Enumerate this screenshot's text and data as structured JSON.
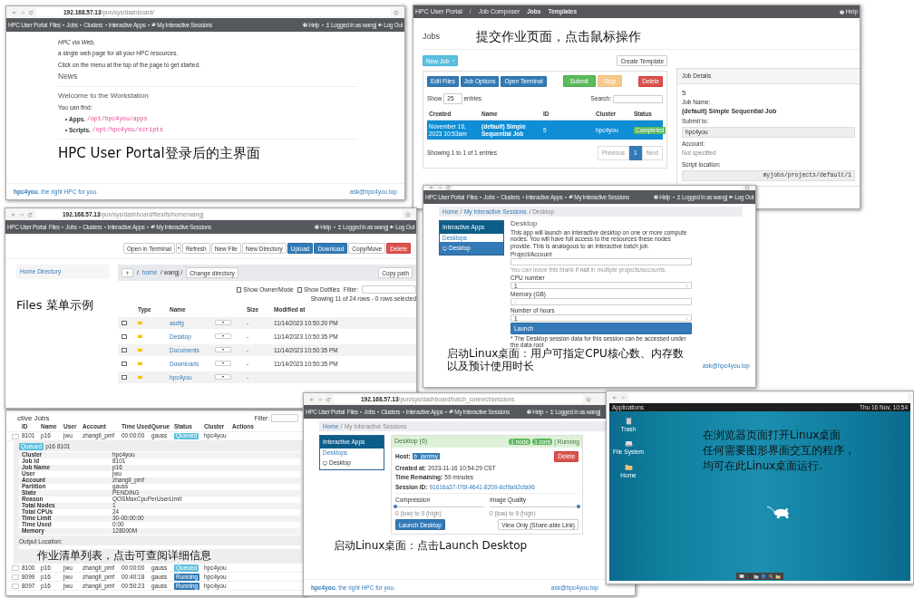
{
  "dashboard": {
    "browser": {
      "host": "192.168.57.13",
      "path": "/pun/sys/dashboard/"
    },
    "nav": {
      "brand": "HPC User Portal",
      "items": [
        {
          "label": "Files",
          "kind": "menu"
        },
        {
          "label": "Jobs",
          "kind": "menu"
        },
        {
          "label": "Clusters",
          "kind": "menu"
        },
        {
          "label": "Interactive Apps",
          "kind": "menu"
        },
        {
          "label": "My Interactive Sessions",
          "kind": "sessions"
        }
      ],
      "right": [
        {
          "label": "Help",
          "kind": "help"
        },
        {
          "label": "Logged in as wangj",
          "kind": "user"
        },
        {
          "label": "Log Out",
          "kind": "logout"
        }
      ]
    },
    "intro": [
      "*HPC via Web*,",
      "a single web page for all your HPC resources.",
      "Click on the menu at the top of the page to get started."
    ],
    "news_title": "News",
    "welcome": "Welcome to the Workstation",
    "find": "You can find:",
    "items": [
      {
        "label": "Apps.",
        "path": "/opt/hpc4you/apps"
      },
      {
        "label": "Scripts.",
        "path": "/opt/hpc4you/scripts"
      }
    ],
    "caption": "HPC User Portal登录后的主界面",
    "footer_left": "**hpc4you**, the right HPC for you.",
    "footer_right": "ask@hpc4you.top"
  },
  "job_composer": {
    "nav": {
      "brand": "HPC User Portal",
      "sep": "/",
      "title": "Job Composer",
      "links": [
        "Jobs",
        "Templates"
      ],
      "help": "Help"
    },
    "title": "Jobs",
    "caption": "提交作业页面，点击鼠标操作",
    "new_job": "New Job",
    "create_template": "Create Template",
    "actions": [
      {
        "label": "Edit Files",
        "kind": "primary"
      },
      {
        "label": "Job Options",
        "kind": "primary"
      },
      {
        "label": "Open Terminal",
        "kind": "primary"
      },
      {
        "label": "Submit",
        "kind": "success"
      },
      {
        "label": "Stop",
        "kind": "warning"
      },
      {
        "label": "Delete",
        "kind": "danger"
      }
    ],
    "show": "Show",
    "page_size": "25",
    "entries": "entries",
    "search": "Search:",
    "columns": [
      "Created",
      "Name",
      "ID",
      "Cluster",
      "Status"
    ],
    "rows": [
      {
        "created": "November 16, 2023 10:53am",
        "name": "(default) Simple Sequential Job",
        "id": "5",
        "cluster": "hpc4you",
        "status": "Completed",
        "selected": true
      }
    ],
    "summary": "Showing 1 to 1 of 1 entries",
    "pager": [
      {
        "label": "Previous",
        "selected": false
      },
      {
        "label": "1",
        "selected": true
      },
      {
        "label": "Next",
        "selected": false
      }
    ],
    "details": {
      "title": "Job Details",
      "id": "5",
      "job_name_label": "Job Name:",
      "job_name": "(default) Simple Sequential Job",
      "submit_label": "Submit to:",
      "submit": "hpc4you",
      "account_label": "Account:",
      "account": "Not specified",
      "script_label": "Script location:",
      "script": "myjobs/projects/default/1"
    }
  },
  "files": {
    "browser": {
      "host": "192.168.57.13",
      "path": "/pun/sys/dashboard/files/fs/home/wangj"
    },
    "nav": {
      "brand": "HPC User Portal",
      "items": [
        {
          "label": "Files",
          "kind": "menu"
        },
        {
          "label": "Jobs",
          "kind": "menu"
        },
        {
          "label": "Clusters",
          "kind": "menu"
        },
        {
          "label": "Interactive Apps",
          "kind": "menu"
        },
        {
          "label": "My Interactive Sessions",
          "kind": "sessions"
        }
      ],
      "right": [
        {
          "label": "Help",
          "kind": "help"
        },
        {
          "label": "Logged in as wangj",
          "kind": "user"
        },
        {
          "label": "Log Out",
          "kind": "logout"
        }
      ]
    },
    "toolbar": [
      {
        "label": "Open in Terminal",
        "kind": "terminal"
      },
      {
        "label": "Refresh",
        "kind": "default"
      },
      {
        "label": "New File",
        "kind": "default"
      },
      {
        "label": "New Directory",
        "kind": "default"
      },
      {
        "label": "Upload",
        "kind": "primary"
      },
      {
        "label": "Download",
        "kind": "primary"
      },
      {
        "label": "Copy/Move",
        "kind": "default"
      },
      {
        "label": "Delete",
        "kind": "danger"
      }
    ],
    "sidebar": "Home Directory",
    "caption": "Files 菜单示例",
    "path": {
      "root": "/",
      "link": "home",
      "rest": "/ wangj /"
    },
    "change_dir": "Change directory",
    "copy_path": "Copy path",
    "options": [
      {
        "label": "Show Owner/Mode",
        "checked": false
      },
      {
        "label": "Show Dotfiles",
        "checked": false
      }
    ],
    "filter": "Filter:",
    "summary": "Showing 11 of 24 rows - 0 rows selected",
    "columns": [
      "Type",
      "Name",
      "Size",
      "Modified at"
    ],
    "rows": [
      {
        "name": "asdfg",
        "size": "-",
        "modified": "11/14/2023 10:50:20 PM",
        "checked": false
      },
      {
        "name": "Desktop",
        "size": "-",
        "modified": "11/14/2023 10:50:35 PM",
        "checked": false
      },
      {
        "name": "Documents",
        "size": "-",
        "modified": "11/14/2023 10:50:35 PM",
        "checked": false
      },
      {
        "name": "Downloads",
        "size": "-",
        "modified": "11/14/2023 10:50:35 PM",
        "checked": false
      },
      {
        "name": "hpc4you",
        "size": "-",
        "checked": false
      }
    ]
  },
  "desktop_form": {
    "nav": {
      "brand": "HPC User Portal",
      "items": [
        {
          "label": "Files",
          "kind": "menu"
        },
        {
          "label": "Jobs",
          "kind": "menu"
        },
        {
          "label": "Clusters",
          "kind": "menu"
        },
        {
          "label": "Interactive Apps",
          "kind": "menu"
        },
        {
          "label": "My Interactive Sessions",
          "kind": "sessions"
        }
      ],
      "right": [
        {
          "label": "Help",
          "kind": "help"
        },
        {
          "label": "Logged in as wangj",
          "kind": "user"
        },
        {
          "label": "Log Out",
          "kind": "logout"
        }
      ]
    },
    "breadcrumb": [
      {
        "label": "Home",
        "current": false
      },
      {
        "label": "My Interactive Sessions",
        "current": false
      },
      {
        "label": "Desktop",
        "current": true
      }
    ],
    "sidebar": {
      "title": "Interactive Apps",
      "group": "Desktops",
      "item": "Desktop"
    },
    "title": "Desktop",
    "description": "This app will launch an interactive desktop on one or more compute nodes. You will have full access to the resources these nodes provide. This is analogous to an interactive batch job.",
    "fields": [
      {
        "label": "Project/Account",
        "kind": "text",
        "help": "You can leave this blank if **not** in multiple projects/accounts."
      },
      {
        "label": "CPU number",
        "kind": "number",
        "value": "1"
      },
      {
        "label": "Memory (GB)",
        "kind": "number"
      },
      {
        "label": "Number of hours",
        "kind": "number",
        "value": "1"
      }
    ],
    "launch": "Launch",
    "note": "* The Desktop session data for this session can be accessed under the data root",
    "caption": "启动Linux桌面：用户可指定CPU核心数、内存数以及预计使用时长",
    "footer_right": "ask@hpc4you.top"
  },
  "active_jobs": {
    "title": "ctive Jobs",
    "filter": "Filter:",
    "columns": [
      "ID",
      "Name",
      "User",
      "Account",
      "Time Used",
      "Queue",
      "Status",
      "Cluster",
      "Actions"
    ],
    "expanded": {
      "id": "8101",
      "name": "p16",
      "user": "jwu",
      "account": "zhangll_pmf",
      "time": "00:00:00",
      "queue": "gauss",
      "status": "Queued",
      "cluster": "hpc4you",
      "head": [
        "Queued",
        "p16",
        "8101"
      ],
      "details": [
        [
          "Cluster",
          "hpc4you"
        ],
        [
          "Job Id",
          "8101"
        ],
        [
          "Job Name",
          "p16"
        ],
        [
          "User",
          "jwu"
        ],
        [
          "Account",
          "zhangll_pmf"
        ],
        [
          "Partition",
          "gauss"
        ],
        [
          "State",
          "PENDING"
        ],
        [
          "Reason",
          "QOSMaxCpuPerUserLimit"
        ],
        [
          "Total Nodes",
          "1"
        ],
        [
          "Total CPUs",
          "24"
        ],
        [
          "Time Limit",
          "30-00:00:00"
        ],
        [
          "Time Used",
          "0:00"
        ],
        [
          "Memory",
          "128000M"
        ]
      ],
      "output_label": "Output Location:"
    },
    "caption": "作业清单列表，点击可查阅详细信息",
    "rows": [
      {
        "id": "8100",
        "name": "p16",
        "user": "jwu",
        "account": "zhangll_pmf",
        "time": "00:00:00",
        "queue": "gauss",
        "status": "Queued",
        "cluster": "hpc4you"
      },
      {
        "id": "8099",
        "name": "p16",
        "user": "jwu",
        "account": "zhangll_pmf",
        "time": "00:40:18",
        "queue": "gauss",
        "status": "Running",
        "cluster": "hpc4you"
      },
      {
        "id": "8097",
        "name": "p16",
        "user": "jwu",
        "account": "zhangll_pmf",
        "time": "00:50:23",
        "queue": "gauss",
        "status": "Running",
        "cluster": "hpc4you"
      }
    ]
  },
  "session": {
    "browser": {
      "host": "192.168.57.13",
      "path": "/pun/sys/dashboard/batch_connect/sessions"
    },
    "nav": {
      "brand": "HPC User Portal",
      "items": [
        {
          "label": "Files",
          "kind": "menu"
        },
        {
          "label": "Jobs",
          "kind": "menu"
        },
        {
          "label": "Clusters",
          "kind": "menu"
        },
        {
          "label": "Interactive Apps",
          "kind": "menu"
        },
        {
          "label": "My Interactive Sessions",
          "kind": "sessions"
        }
      ],
      "right": [
        {
          "label": "Help",
          "kind": "help"
        },
        {
          "label": "Logged in as wangj",
          "kind": "user"
        }
      ]
    },
    "breadcrumb": [
      {
        "label": "Home",
        "current": false
      },
      {
        "label": "My Interactive Sessions",
        "current": true
      }
    ],
    "sidebar": {
      "title": "Interactive Apps",
      "group": "Desktops",
      "item": "Desktop"
    },
    "card_title": "Desktop (6)",
    "badges": [
      "1 node",
      "1 core"
    ],
    "state": "| Running",
    "host_label": "Host:",
    "host": "b_jammy",
    "created_label": "Created at:",
    "created": "2023-11-16 10:54:29 CST",
    "remaining_label": "Time Remaining:",
    "remaining": "59 minutes",
    "session_label": "Session ID:",
    "session_id": "91616a37-f76f-4641-8209-6cf9a92cfa96",
    "delete": "Delete",
    "sliders": [
      {
        "label": "Compression",
        "level": 0,
        "hint": "0 (low) to 9 (high)"
      },
      {
        "label": "Image Quality",
        "level": 1,
        "hint": "0 (low) to 9 (high)"
      }
    ],
    "launch": "Launch Desktop",
    "view_only": "View Only (Share-able Link)",
    "caption": "启动Linux桌面：点击Launch Desktop",
    "footer_left": "**hpc4you**, the right HPC for you.",
    "footer_right": "ask@hpc4you.top"
  },
  "linux_desktop": {
    "menu": "Applications",
    "clock": "Thu 16 Nov, 10:54",
    "icons": [
      {
        "label": "Trash",
        "kind": "trash"
      },
      {
        "label": "File System",
        "kind": "drive"
      },
      {
        "label": "Home",
        "kind": "folder"
      }
    ],
    "caption": [
      "在浏览器页面打开Linux桌面",
      "任何需要图形界面交互的程序，",
      "均可在此Linux桌面运行."
    ]
  }
}
